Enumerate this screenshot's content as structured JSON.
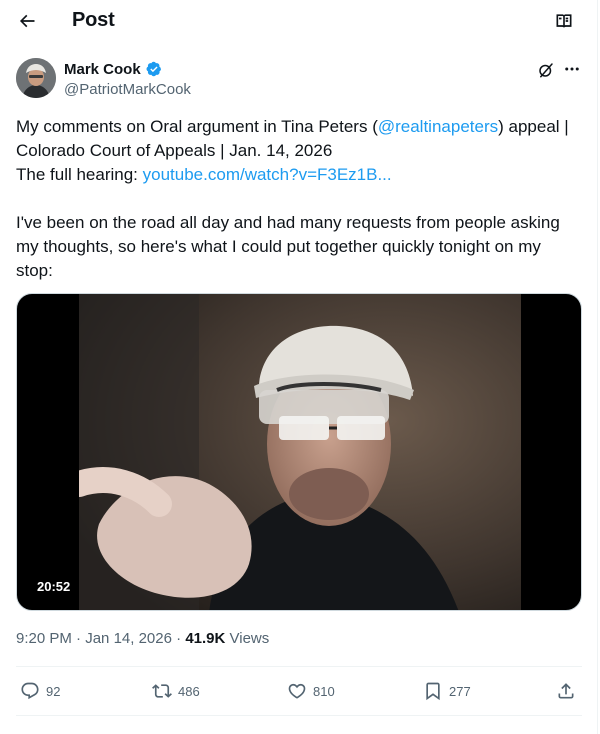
{
  "header": {
    "title": "Post"
  },
  "author": {
    "name": "Mark Cook",
    "handle": "@PatriotMarkCook"
  },
  "post": {
    "line1_pre": "My comments on Oral argument in Tina Peters (",
    "mention": "@realtinapeters",
    "line1_post": ") appeal |",
    "line2": "Colorado Court of Appeals | Jan. 14, 2026",
    "line3_pre": "The full hearing: ",
    "link": "youtube.com/watch?v=F3Ez1B...",
    "paragraph2_line1": "I've been on the road all day and had many requests from people asking",
    "paragraph2_line2": "my thoughts, so here's what I could put together quickly tonight on my",
    "paragraph2_line3": "stop:"
  },
  "video": {
    "duration": "20:52"
  },
  "meta": {
    "time": "9:20 PM",
    "separator": " · ",
    "date": "Jan 14, 2026",
    "views_count": "41.9K",
    "views_label": " Views"
  },
  "actions": {
    "replies": "92",
    "reposts": "486",
    "likes": "810",
    "bookmarks": "277"
  },
  "colors": {
    "link": "#1d9bf0",
    "verified": "#1d9bf0",
    "text": "#0f1419",
    "secondary": "#536471"
  }
}
